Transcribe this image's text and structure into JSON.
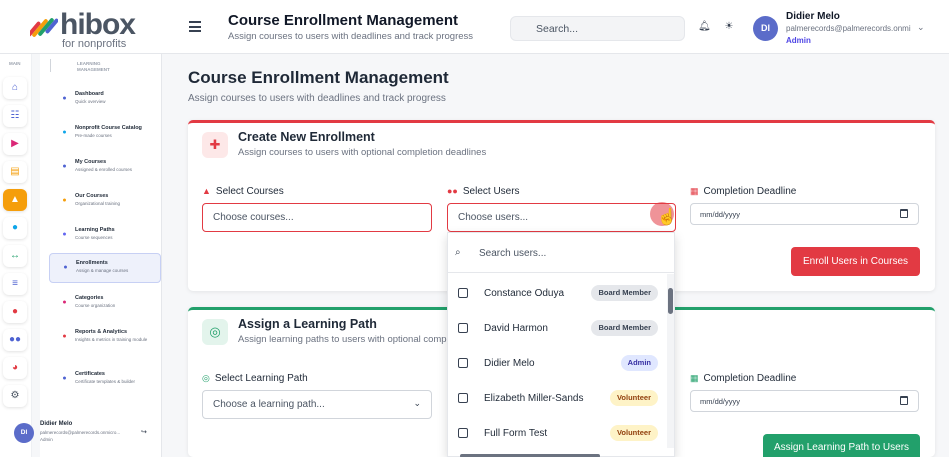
{
  "brand": {
    "name": "hibox",
    "tagline": "for nonprofits"
  },
  "topbar": {
    "title": "Course Enrollment Management",
    "subtitle": "Assign courses to users with deadlines and track progress",
    "search_placeholder": "Search...",
    "user": {
      "initials": "DI",
      "name": "Didier Melo",
      "email": "palmerecords@palmerecords.onmi...",
      "role": "Admin"
    }
  },
  "rail": {
    "section_label": "MAIN"
  },
  "nav": {
    "section_label": "LEARNING MANAGEMENT",
    "items": [
      {
        "title": "Dashboard",
        "subtitle": "Quick overview",
        "color": "#4f63d2"
      },
      {
        "title": "Nonprofit Course Catalog",
        "subtitle": "Pre-made courses",
        "color": "#0ea5e9"
      },
      {
        "title": "My Courses",
        "subtitle": "Assigned & enrolled courses",
        "color": "#4f63d2"
      },
      {
        "title": "Our Courses",
        "subtitle": "Organizational training",
        "color": "#f59e0b"
      },
      {
        "title": "Learning Paths",
        "subtitle": "Course sequences",
        "color": "#6366f1"
      },
      {
        "title": "Enrollments",
        "subtitle": "Assign & manage courses",
        "color": "#4f63d2"
      },
      {
        "title": "Categories",
        "subtitle": "Course organization",
        "color": "#db2777"
      },
      {
        "title": "Reports & Analytics",
        "subtitle": "Insights & metrics in training module",
        "color": "#e23a43"
      },
      {
        "title": "Certificates",
        "subtitle": "Certificate templates & builder",
        "color": "#4f63d2"
      }
    ],
    "user": {
      "initials": "DI",
      "name": "Didier Melo",
      "email": "palmerecords@palmerecords.onmicro...",
      "role": "Admin"
    }
  },
  "page": {
    "title": "Course Enrollment Management",
    "subtitle": "Assign courses to users with deadlines and track progress"
  },
  "create_enrollment": {
    "title": "Create New Enrollment",
    "subtitle": "Assign courses to users with optional completion deadlines",
    "courses_label": "Select Courses",
    "courses_placeholder": "Choose courses...",
    "users_label": "Select Users",
    "users_placeholder": "Choose users...",
    "deadline_label": "Completion Deadline",
    "deadline_placeholder": "mm/dd/yyyy",
    "submit_label": "Enroll Users in Courses"
  },
  "users_dropdown": {
    "search_placeholder": "Search users...",
    "options": [
      {
        "name": "Constance Oduya",
        "role": "Board Member",
        "checked": false
      },
      {
        "name": "David Harmon",
        "role": "Board Member",
        "checked": false
      },
      {
        "name": "Didier Melo",
        "role": "Admin",
        "checked": false
      },
      {
        "name": "Elizabeth Miller-Sands",
        "role": "Volunteer",
        "checked": false
      },
      {
        "name": "Full Form Test",
        "role": "Volunteer",
        "checked": false
      }
    ]
  },
  "learning_path": {
    "title": "Assign a Learning Path",
    "subtitle": "Assign learning paths to users with optional completion deadlines",
    "path_label": "Select Learning Path",
    "path_placeholder": "Choose a learning path...",
    "deadline_label": "Completion Deadline",
    "deadline_placeholder": "mm/dd/yyyy",
    "submit_label": "Assign Learning Path to Users"
  },
  "colors": {
    "accent_red": "#e23a43",
    "accent_green": "#22a06b",
    "active_orange": "#f59e0b",
    "avatar": "#5b6cc9"
  }
}
